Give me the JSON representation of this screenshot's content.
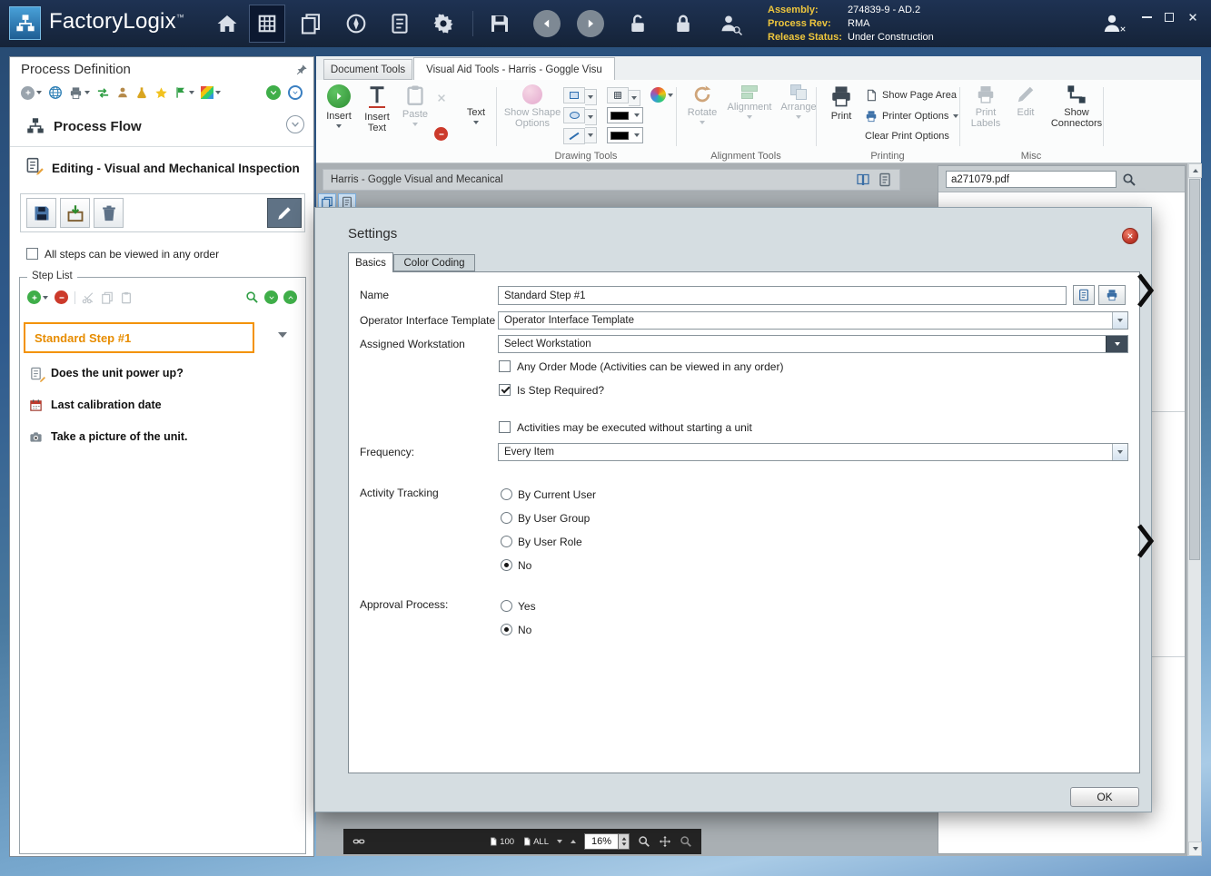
{
  "colors": {
    "titlebar": "#17253d",
    "accent_orange": "#f39200",
    "label_gold": "#eec63d",
    "dialog_bg": "#d5dde1"
  },
  "window": {
    "app_name": "FactoryLogix",
    "trademark": "™",
    "info_rows": [
      {
        "label": "Assembly:",
        "value": "274839-9 - AD.2"
      },
      {
        "label": "Process Rev:",
        "value": "RMA"
      },
      {
        "label": "Release Status:",
        "value": "Under Construction"
      }
    ]
  },
  "left_panel": {
    "title": "Process Definition",
    "process_flow_label": "Process Flow",
    "editing_title": "Editing - Visual and Mechanical Inspection",
    "order_checkbox_label": "All steps can be viewed in any order",
    "order_checkbox_checked": false,
    "step_list_title": "Step List",
    "steps": [
      {
        "label": "Standard Step #1",
        "selected": true
      },
      {
        "label": "Does the unit power up?",
        "selected": false
      },
      {
        "label": "Last calibration date",
        "selected": false
      },
      {
        "label": "Take a picture of the unit.",
        "selected": false
      }
    ]
  },
  "ribbon": {
    "tabs": [
      {
        "label": "Document Tools",
        "active": false
      },
      {
        "label": "Visual Aid Tools - Harris - Goggle Visu",
        "active": true
      }
    ],
    "buttons": {
      "insert": "Insert",
      "insert_text_line1": "Insert",
      "insert_text_line2": "Text",
      "paste": "Paste",
      "text": "Text",
      "show_shape_line1": "Show Shape",
      "show_shape_line2": "Options",
      "rotate": "Rotate",
      "alignment": "Alignment",
      "arrange": "Arrange",
      "print": "Print",
      "show_page_area": "Show Page Area",
      "printer_options": "Printer Options",
      "clear_print_options": "Clear Print Options",
      "print_labels_line1": "Print",
      "print_labels_line2": "Labels",
      "edit": "Edit",
      "show_connectors_line1": "Show",
      "show_connectors_line2": "Connectors"
    },
    "group_labels": [
      "Drawing Tools",
      "Alignment Tools",
      "Printing",
      "Misc"
    ]
  },
  "document": {
    "title": "Harris - Goggle Visual and Mecanical",
    "pdf_name": "a271079.pdf",
    "zoom_value": "16%",
    "zoom_preset_100": "100",
    "zoom_preset_all": "ALL"
  },
  "dialog": {
    "title": "Settings",
    "tabs": [
      {
        "label": "Basics",
        "active": true
      },
      {
        "label": "Color Coding",
        "active": false
      }
    ],
    "name_label": "Name",
    "name_value": "Standard Step #1",
    "operator_interface_label": "Operator Interface Template",
    "operator_interface_value": "Operator Interface Template",
    "workstation_label": "Assigned Workstation",
    "workstation_value": "Select Workstation",
    "checkbox_any_order_label": "Any Order Mode (Activities can be viewed in any order)",
    "checkbox_any_order_checked": false,
    "checkbox_required_label": "Is Step Required?",
    "checkbox_required_checked": true,
    "checkbox_activities_label": "Activities may be executed without starting a unit",
    "checkbox_activities_checked": false,
    "frequency_label": "Frequency:",
    "frequency_value": "Every Item",
    "activity_tracking_label": "Activity Tracking",
    "activity_options": [
      {
        "label": "By Current User",
        "selected": false
      },
      {
        "label": "By User Group",
        "selected": false
      },
      {
        "label": "By User Role",
        "selected": false
      },
      {
        "label": "No",
        "selected": true
      }
    ],
    "approval_label": "Approval Process:",
    "approval_options": [
      {
        "label": "Yes",
        "selected": false
      },
      {
        "label": "No",
        "selected": true
      }
    ],
    "ok_label": "OK"
  }
}
